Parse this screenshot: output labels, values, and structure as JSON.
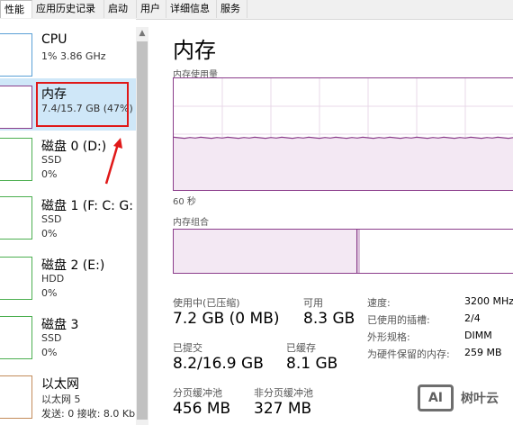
{
  "tabs": [
    "性能",
    "应用历史记录",
    "启动",
    "用户",
    "详细信息",
    "服务"
  ],
  "sidebar": {
    "items": [
      {
        "title": "CPU",
        "sub1": "1% 3.86 GHz",
        "sub2": ""
      },
      {
        "title": "内存",
        "sub1": "7.4/15.7 GB (47%)",
        "sub2": ""
      },
      {
        "title": "磁盘 0 (D:)",
        "sub1": "SSD",
        "sub2": "0%"
      },
      {
        "title": "磁盘 1 (F: C: G:",
        "sub1": "SSD",
        "sub2": "0%"
      },
      {
        "title": "磁盘 2 (E:)",
        "sub1": "HDD",
        "sub2": "0%"
      },
      {
        "title": "磁盘 3",
        "sub1": "SSD",
        "sub2": "0%"
      },
      {
        "title": "以太网",
        "sub1": "以太网 5",
        "sub2": "发送: 0 接收: 8.0 Kb"
      }
    ],
    "selected_index": 1
  },
  "main": {
    "title": "内存",
    "usage_label": "内存使用量",
    "time_label": "60 秒",
    "composition_label": "内存组合",
    "usage_fraction": 0.47,
    "stats": {
      "in_use_label": "使用中(已压缩)",
      "in_use_value": "7.2 GB (0 MB)",
      "available_label": "可用",
      "available_value": "8.3 GB",
      "committed_label": "已提交",
      "committed_value": "8.2/16.9 GB",
      "cached_label": "已缓存",
      "cached_value": "8.1 GB",
      "paged_label": "分页缓冲池",
      "paged_value": "456 MB",
      "nonpaged_label": "非分页缓冲池",
      "nonpaged_value": "327 MB"
    },
    "details": [
      {
        "key": "速度:",
        "value": "3200 MHz"
      },
      {
        "key": "已使用的插槽:",
        "value": "2/4"
      },
      {
        "key": "外形规格:",
        "value": "DIMM"
      },
      {
        "key": "为硬件保留的内存:",
        "value": "259 MB"
      }
    ]
  },
  "watermark": {
    "logo": "AI",
    "text": "树叶云"
  },
  "colors": {
    "memory": "#8b3d8b",
    "selected": "#cfe7f8",
    "highlight": "#e01818"
  }
}
